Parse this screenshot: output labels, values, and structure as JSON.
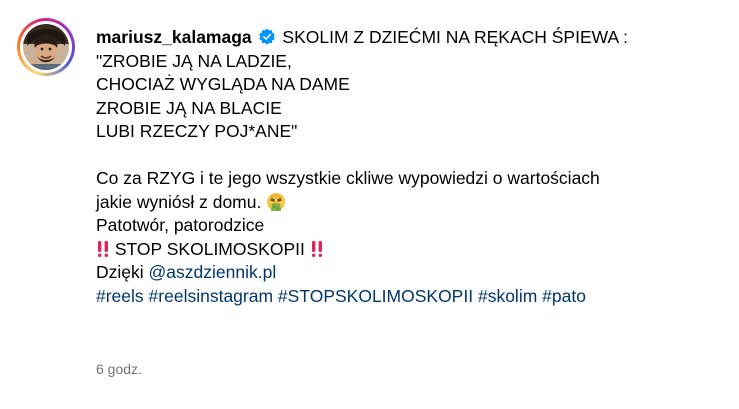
{
  "post": {
    "username": "mariusz_kalamaga",
    "caption_lines": [
      "SKOLIM Z DZIEĆMI NA RĘKACH ŚPIEWA :",
      "\"ZROBIE JĄ NA LADZIE,",
      "CHOCIAŻ WYGLĄDA NA DAME",
      "ZROBIE JĄ NA BLACIE",
      "LUBI RZECZY POJ*ANE\"",
      "",
      "Co za RZYG i te jego wszystkie ckliwe wypowiedzi o wartościach",
      "jakie wyniósł z domu.",
      "Patotwór, patorodzice",
      "STOP SKOLIMOSKOPII",
      "Dzięki"
    ],
    "mention": "@aszdziennik.pl",
    "hashtags": [
      "#reels",
      "#reelsinstagram",
      "#STOPSKOLIMOSKOPII",
      "#skolim",
      "#pato"
    ],
    "timestamp": "6 godz.",
    "icons": {
      "verified": "verified-badge-icon",
      "vomit_emoji": "face-vomiting-emoji",
      "double_exclamation": "double-exclamation-emoji"
    },
    "colors": {
      "link": "#00376b",
      "verified": "#0095f6",
      "muted": "#737373"
    }
  }
}
